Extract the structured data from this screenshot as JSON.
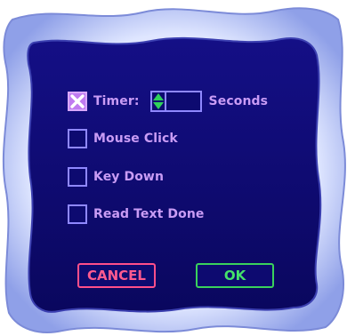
{
  "dialog": {
    "options": [
      {
        "label": "Timer:",
        "checked": true
      },
      {
        "label": "Mouse Click",
        "checked": false
      },
      {
        "label": "Key Down",
        "checked": false
      },
      {
        "label": "Read Text Done",
        "checked": false
      }
    ],
    "timer": {
      "value": "",
      "unit_label": "Seconds"
    },
    "buttons": {
      "cancel_label": "CANCEL",
      "ok_label": "OK"
    }
  },
  "colors": {
    "panel": "#0d0a70",
    "label_text": "#c99cf5",
    "checkbox_border": "#8f88ff",
    "checked_fill": "#c07bf0",
    "cancel": "#ff4f8a",
    "ok": "#3ad25c"
  }
}
